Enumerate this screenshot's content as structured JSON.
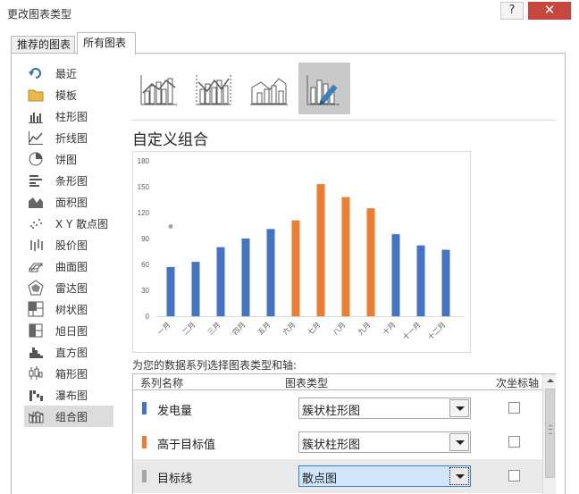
{
  "window": {
    "title": "更改图表类型",
    "help_label": "?",
    "close_label": "✕"
  },
  "tabs": [
    {
      "label": "推荐的图表",
      "active": false
    },
    {
      "label": "所有图表",
      "active": true
    }
  ],
  "sidebar": {
    "items": [
      {
        "label": "最近",
        "icon": "recent-icon"
      },
      {
        "label": "模板",
        "icon": "folder-icon"
      },
      {
        "label": "柱形图",
        "icon": "column-chart-icon"
      },
      {
        "label": "折线图",
        "icon": "line-chart-icon"
      },
      {
        "label": "饼图",
        "icon": "pie-chart-icon"
      },
      {
        "label": "条形图",
        "icon": "bar-chart-icon"
      },
      {
        "label": "面积图",
        "icon": "area-chart-icon"
      },
      {
        "label": "X Y 散点图",
        "icon": "scatter-chart-icon"
      },
      {
        "label": "股价图",
        "icon": "stock-chart-icon"
      },
      {
        "label": "曲面图",
        "icon": "surface-chart-icon"
      },
      {
        "label": "雷达图",
        "icon": "radar-chart-icon"
      },
      {
        "label": "树状图",
        "icon": "treemap-chart-icon"
      },
      {
        "label": "旭日图",
        "icon": "sunburst-chart-icon"
      },
      {
        "label": "直方图",
        "icon": "histogram-chart-icon"
      },
      {
        "label": "箱形图",
        "icon": "box-whisker-chart-icon"
      },
      {
        "label": "瀑布图",
        "icon": "waterfall-chart-icon"
      },
      {
        "label": "组合图",
        "icon": "combo-chart-icon",
        "selected": true
      }
    ]
  },
  "combo_types": [
    {
      "icon": "clustered-column-line-icon"
    },
    {
      "icon": "clustered-column-line-secondary-icon"
    },
    {
      "icon": "stacked-area-column-icon"
    },
    {
      "icon": "custom-combination-icon",
      "selected": true
    }
  ],
  "section_title": "自定义组合",
  "chart_data": {
    "type": "bar",
    "categories": [
      "一月",
      "二月",
      "三月",
      "四月",
      "五月",
      "六月",
      "七月",
      "八月",
      "九月",
      "十月",
      "十一月",
      "十二月"
    ],
    "values": [
      57,
      63,
      80,
      90,
      101,
      111,
      153,
      138,
      125,
      95,
      82,
      77
    ],
    "bar_colors": [
      "#4472c4",
      "#4472c4",
      "#4472c4",
      "#4472c4",
      "#4472c4",
      "#ed7d31",
      "#ed7d31",
      "#ed7d31",
      "#ed7d31",
      "#4472c4",
      "#4472c4",
      "#4472c4"
    ],
    "scatter_points": [
      {
        "x": "一月",
        "y": 104
      }
    ],
    "scatter_color": "#a5a5a5",
    "ylim": [
      0,
      180
    ],
    "yticks": [
      0,
      30,
      60,
      90,
      120,
      150,
      180
    ],
    "grid": false,
    "legend": "none"
  },
  "assign_label": "为您的数据系列选择图表类型和轴:",
  "series_table": {
    "headers": {
      "name": "系列名称",
      "type": "图表类型",
      "secondary": "次坐标轴"
    },
    "rows": [
      {
        "name": "发电量",
        "color": "#4472c4",
        "chart_type": "簇状柱形图",
        "secondary_axis": false
      },
      {
        "name": "高于目标值",
        "color": "#ed7d31",
        "chart_type": "簇状柱形图",
        "secondary_axis": false
      },
      {
        "name": "目标线",
        "color": "#a5a5a5",
        "chart_type": "散点图",
        "secondary_axis": false,
        "selected": true
      }
    ]
  }
}
